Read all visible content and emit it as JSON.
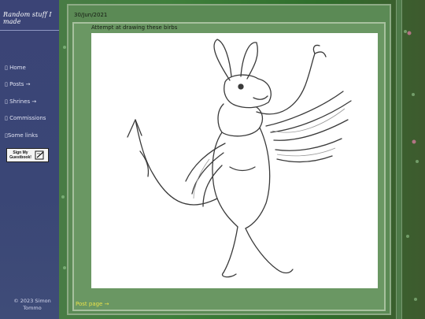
{
  "sidebar": {
    "title": "Random stuff I made",
    "nav": [
      {
        "label": "Home",
        "icon": "door-icon"
      },
      {
        "label": "Posts →",
        "icon": "door-icon"
      },
      {
        "label": "Shrines →",
        "icon": "door-icon"
      },
      {
        "label": "Commissions",
        "icon": "door-icon"
      },
      {
        "label": "Some links",
        "icon": "door-icon"
      }
    ],
    "guestbook_label": "Sign My Guestbook!",
    "footer": "© 2023 Simon Tommo"
  },
  "post": {
    "date": "30/Jun/2021",
    "caption": "Attempt at drawing these birbs",
    "next_link": "Post page →"
  },
  "colors": {
    "sidebar_bg": "#3b4476",
    "page_bg": "#3f7f3c",
    "link": "#e8e24a"
  }
}
